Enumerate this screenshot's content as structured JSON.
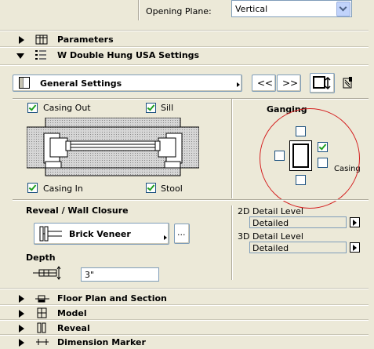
{
  "opening_plane": {
    "label": "Opening Plane:",
    "value": "Vertical"
  },
  "sections": {
    "parameters": "Parameters",
    "settings": "W Double Hung USA Settings",
    "floor_plan": "Floor Plan and Section",
    "model": "Model",
    "reveal": "Reveal",
    "dimension_marker": "Dimension Marker"
  },
  "general_settings": {
    "label": "General Settings",
    "prev": "<<",
    "next": ">>"
  },
  "casing": {
    "casing_out": "Casing Out",
    "sill": "Sill",
    "casing_in": "Casing In",
    "stool": "Stool"
  },
  "ganging": {
    "title": "Ganging",
    "casing_label": "Casing"
  },
  "reveal_closure": {
    "title": "Reveal / Wall Closure",
    "value": "Brick Veneer",
    "more": "..."
  },
  "depth": {
    "title": "Depth",
    "value": "3\""
  },
  "detail_2d": {
    "label": "2D Detail Level",
    "value": "Detailed"
  },
  "detail_3d": {
    "label": "3D Detail Level",
    "value": "Detailed"
  },
  "colors": {
    "panel_bg": "#ece9d8",
    "annotation_red": "#d42020",
    "check_green": "#21a121"
  }
}
